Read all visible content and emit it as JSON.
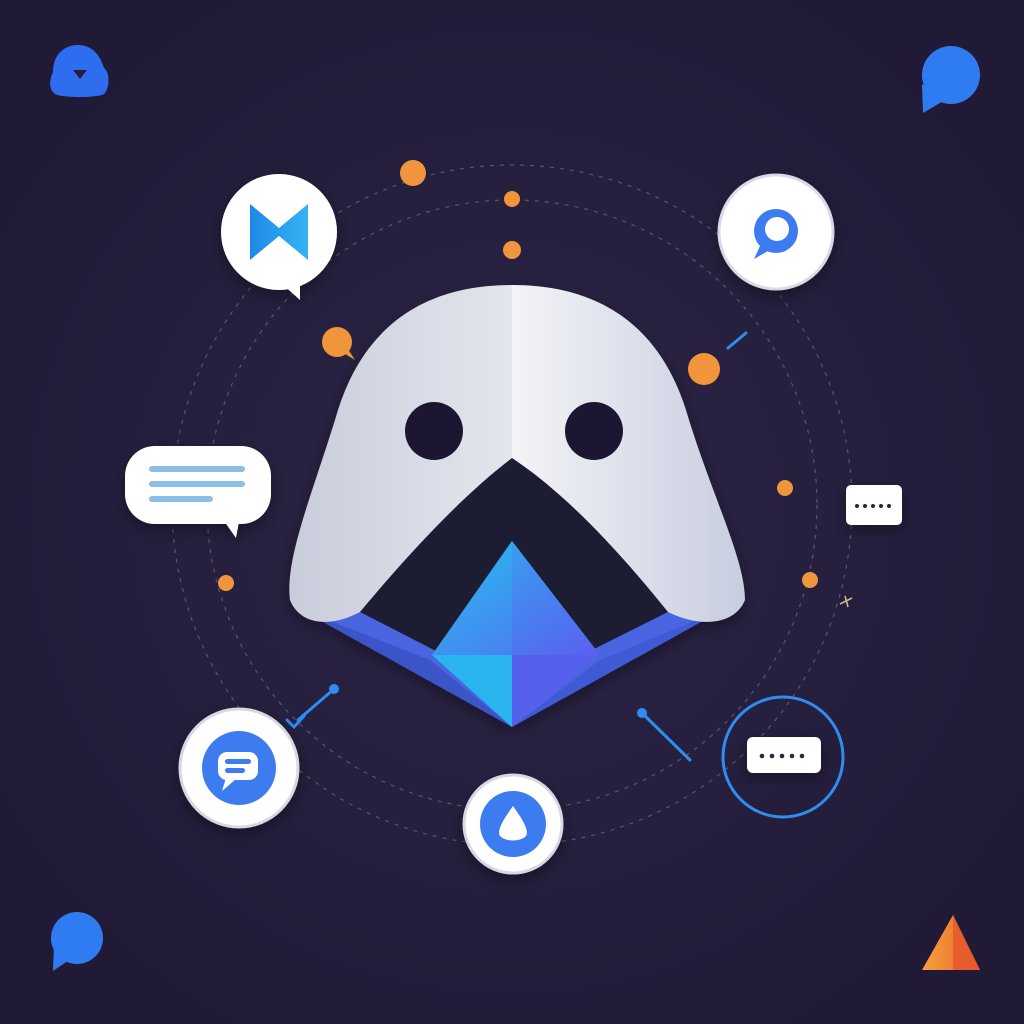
{
  "colors": {
    "background": "#231d3a",
    "accent_blue": "#3d7cf0",
    "accent_orange": "#f0953c",
    "mascot_white": "#eef0f5",
    "ring": "#5a5470"
  },
  "icons": [
    "mascot-logo",
    "bowtie-chat-bubble-icon",
    "search-chat-icon",
    "text-lines-chat-bubble-icon",
    "typing-dots-badge-icon",
    "message-circle-icon",
    "droplet-circle-icon",
    "typing-dots-ring-icon",
    "corner-chat-bubble-icons",
    "corner-triangle-icon"
  ]
}
